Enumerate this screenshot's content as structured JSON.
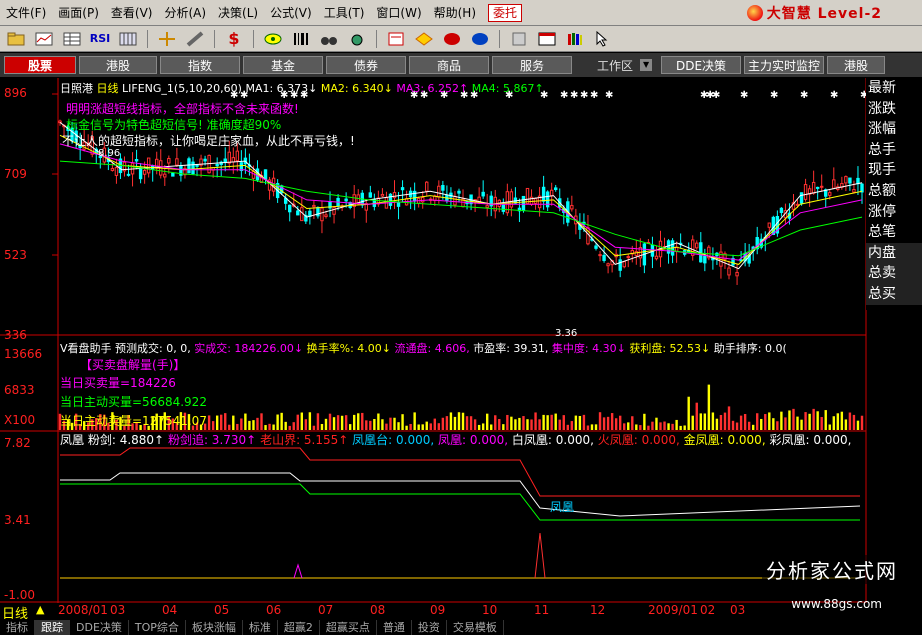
{
  "menubar": {
    "items": [
      "文件(F)",
      "画面(P)",
      "查看(V)",
      "分析(A)",
      "决策(L)",
      "公式(V)",
      "工具(T)",
      "窗口(W)",
      "帮助(H)"
    ],
    "entrust": "委托",
    "brand": "大智慧 Level-2"
  },
  "toolbar": {
    "rsi_label": "RSI"
  },
  "market_bar": {
    "buttons": [
      "股票",
      "港股",
      "指数",
      "基金",
      "债券",
      "商品",
      "服务"
    ],
    "workspace": "工作区",
    "dde": "DDE决策",
    "monitor": "主力实时监控",
    "hk": "港股"
  },
  "main_chart": {
    "stock_name": "日照港",
    "period": "日线",
    "indicator": "LIFENG_1(5,10,20,60)",
    "ma1": "MA1: 6.373↓",
    "ma2": "MA2: 6.340↓",
    "ma3": "MA3: 6.252↑",
    "ma4": "MA4: 5.867↑",
    "line1": "明明涨超短线指标，全部指标不含未来函数!",
    "line2": "标金信号为特色超短信号! 准确度超90%",
    "line3": "不让人的超短指标，让你喝足庄家血，从此不再亏钱，!",
    "high_label": "8.96",
    "low_label": "3.36",
    "y_ticks": [
      "896",
      "709",
      "523",
      "336"
    ]
  },
  "volume_panel": {
    "title": "V看盘助手",
    "fields": [
      "预测成交: 0, 0,",
      "实成交: 184226.00↓",
      "换手率%: 4.00↓",
      "流通盘: 4.606,",
      "市盈率: 39.31,",
      "集中度: 4.30↓",
      "获利盘: 52.53↓",
      "助手排序: 0.0("
    ],
    "sub_title": "【买卖盘解量(手)】",
    "buy_sell": "当日买卖量=184226",
    "main_buy": "当日主动买量=56684.922",
    "main_sell": "当日主动卖量=127541.07",
    "y_ticks": [
      "13666",
      "6833",
      "X100"
    ]
  },
  "phoenix_panel": {
    "fields": [
      "凤凰",
      "粉剑: 4.880↑",
      "粉剑追: 3.730↑",
      "老山界: 5.155↑",
      "凤凰台: 0.000,",
      "凤凰: 0.000,",
      "白凤凰: 0.000,",
      "火凤凰: 0.000,",
      "金凤凰: 0.000,",
      "彩凤凰: 0.000,"
    ],
    "label_in_chart": "凤凰",
    "y_ticks": [
      "7.82",
      "3.41",
      "-1.00"
    ]
  },
  "right_panel": {
    "items": [
      "最新",
      "涨跌",
      "涨幅",
      "总手",
      "现手",
      "总额",
      "涨停",
      "总笔",
      "内盘",
      "总卖",
      "总买"
    ]
  },
  "dates": [
    "2008/01",
    "03",
    "04",
    "05",
    "06",
    "07",
    "08",
    "09",
    "10",
    "11",
    "12",
    "2009/01",
    "02",
    "03"
  ],
  "bottom": {
    "period_label": "日线",
    "tabs": [
      "指标",
      "跟踪",
      "DDE决策",
      "TOP综合",
      "板块涨幅",
      "标准",
      "超赢2",
      "超赢买点",
      "普通",
      "投资",
      "交易模板"
    ]
  },
  "watermark": {
    "text": "分析家公式网",
    "url": "www.88gs.com"
  },
  "chart_data": {
    "type": "line",
    "x": [
      "2008/01",
      "03",
      "04",
      "05",
      "06",
      "07",
      "08",
      "09",
      "10",
      "11",
      "12",
      "2009/01",
      "02",
      "03"
    ],
    "series": [
      {
        "name": "MA1",
        "values": [
          8.3,
          7.2,
          7.3,
          7.4,
          6.1,
          6.5,
          6.7,
          6.4,
          6.6,
          5.0,
          5.5,
          4.9,
          6.6,
          6.9
        ]
      },
      {
        "name": "MA2",
        "values": [
          8.0,
          7.3,
          7.2,
          7.3,
          6.3,
          6.4,
          6.6,
          6.4,
          6.5,
          5.2,
          5.4,
          5.0,
          6.4,
          6.7
        ]
      },
      {
        "name": "MA3",
        "values": [
          7.8,
          7.4,
          7.2,
          7.2,
          6.5,
          6.4,
          6.5,
          6.4,
          6.4,
          5.4,
          5.3,
          5.1,
          6.2,
          6.5
        ]
      },
      {
        "name": "MA4",
        "values": [
          7.4,
          7.3,
          7.1,
          7.0,
          6.7,
          6.5,
          6.4,
          6.3,
          6.2,
          5.7,
          5.3,
          5.2,
          5.8,
          6.1
        ]
      }
    ],
    "ylim": [
      3.36,
      8.96
    ],
    "title": "日照港 日线"
  }
}
